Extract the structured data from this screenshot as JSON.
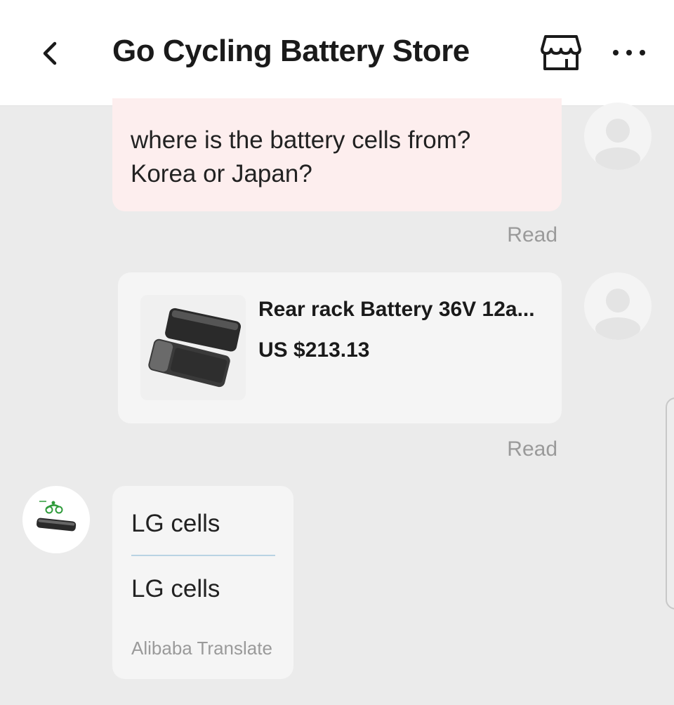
{
  "header": {
    "title": "Go Cycling Battery Store",
    "back_icon": "chevron-left-icon",
    "store_icon": "store-icon",
    "more_icon": "more-horizontal-icon"
  },
  "messages": {
    "outgoing_question": {
      "lines": [
        "where is the battery cells from?",
        "Korea or Japan?"
      ],
      "status": "Read",
      "bubble_color": "#fdeeee"
    },
    "outgoing_product": {
      "title": "Rear rack Battery 36V 12a...",
      "price": "US $213.13",
      "status": "Read"
    },
    "incoming_reply": {
      "original": "LG cells",
      "translated": "LG cells",
      "translator": "Alibaba Translate"
    }
  },
  "colors": {
    "background": "#ebebeb",
    "header_bg": "#ffffff",
    "outgoing_bubble": "#fdeeee",
    "incoming_bubble": "#f5f5f5",
    "muted_text": "#9a9a9a"
  }
}
